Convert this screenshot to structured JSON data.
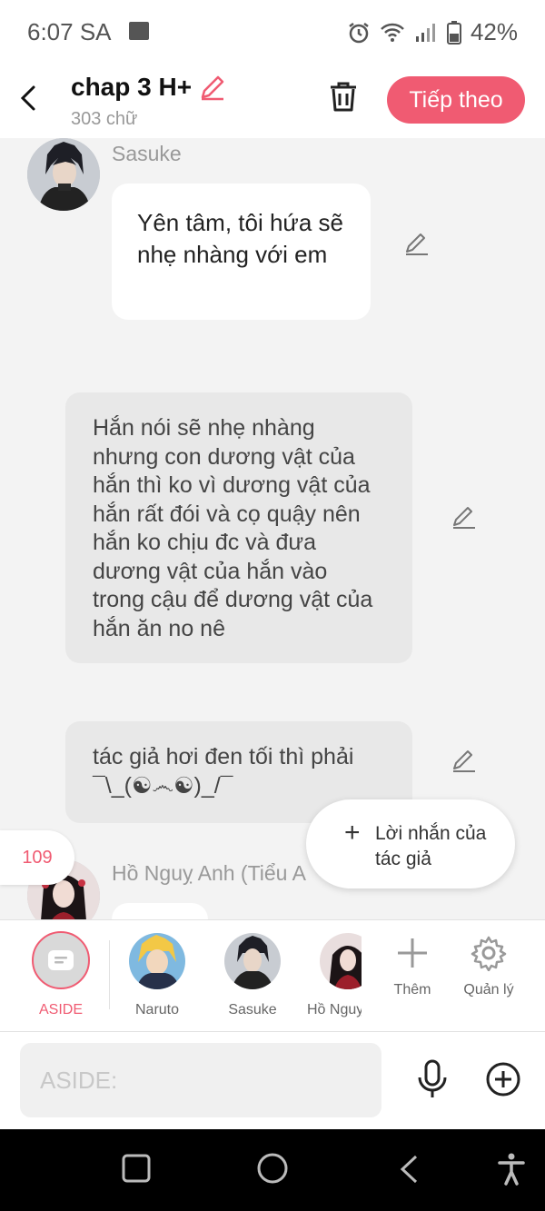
{
  "status_bar": {
    "time": "6:07 SA",
    "battery": "42%"
  },
  "header": {
    "title": "chap 3 H+",
    "word_count": "303 chữ",
    "next_label": "Tiếp theo"
  },
  "messages": [
    {
      "sender": "Sasuke",
      "text": "Yên tâm, tôi hứa sẽ nhẹ nhàng với em"
    },
    {
      "type": "aside",
      "text": "Hắn nói sẽ nhẹ nhàng nhưng con dương vật của hắn thì ko vì dương vật của hắn rất đói và cọ quậy nên hắn ko chịu đc và đưa dương vật của hắn vào trong cậu để dương vật của hắn ăn no nê"
    },
    {
      "type": "aside",
      "text": "tác giả hơi đen tối thì phải ¯\\_(☯෴☯)_/¯"
    },
    {
      "sender": "Hồ Nguỵ Anh (Tiểu A"
    }
  ],
  "count_badge": "109",
  "author_note_label": "Lời nhắn của tác giả",
  "characters": [
    {
      "name": "ASIDE",
      "active": true
    },
    {
      "name": "Naruto"
    },
    {
      "name": "Sasuke"
    },
    {
      "name": "Hồ Nguỵ"
    }
  ],
  "actions": {
    "add_label": "Thêm",
    "manage_label": "Quản lý"
  },
  "input": {
    "placeholder": "ASIDE:"
  },
  "colors": {
    "accent": "#f05b72",
    "background": "#f3f3f3",
    "aside_bubble": "#e8e8e8"
  },
  "icons": [
    "back-icon",
    "pencil-icon",
    "trash-icon",
    "edit-icon",
    "plus-icon",
    "gear-icon",
    "mic-icon",
    "add-circle-icon",
    "square-icon",
    "circle-icon",
    "triangle-back-icon",
    "accessibility-icon"
  ]
}
